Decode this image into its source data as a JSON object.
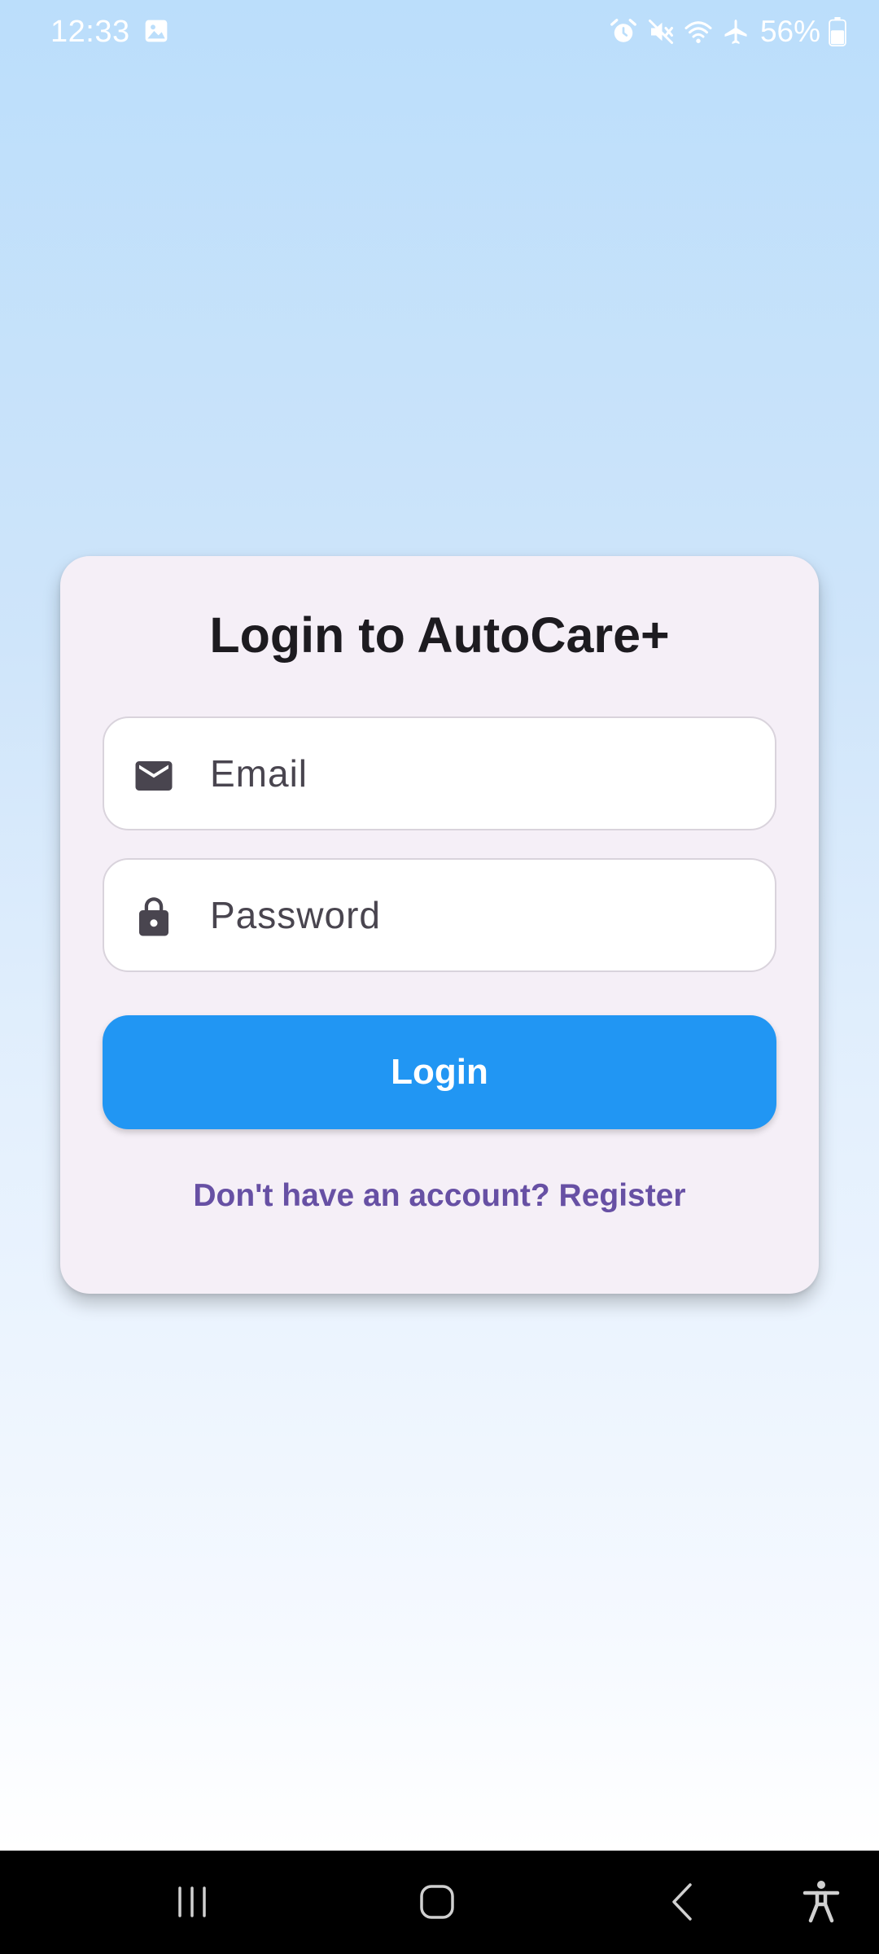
{
  "status_bar": {
    "time": "12:33",
    "battery_percent": "56%",
    "icons": [
      "gallery-icon",
      "alarm-icon",
      "mute-icon",
      "wifi-icon",
      "airplane-mode-icon",
      "battery-icon"
    ]
  },
  "login_card": {
    "title": "Login to AutoCare+",
    "email_field": {
      "placeholder": "Email",
      "value": "",
      "icon": "email-icon"
    },
    "password_field": {
      "placeholder": "Password",
      "value": "",
      "icon": "lock-icon"
    },
    "login_button_label": "Login",
    "register_link_label": "Don't have an account? Register"
  },
  "navigation_bar": {
    "buttons": [
      "recents-icon",
      "home-icon",
      "back-icon",
      "accessibility-icon"
    ]
  },
  "colors": {
    "primary": "#2196f3",
    "link": "#6750a4",
    "card_background": "#f5eff7",
    "background_top": "#bbdefb",
    "background_bottom": "#ffffff"
  }
}
